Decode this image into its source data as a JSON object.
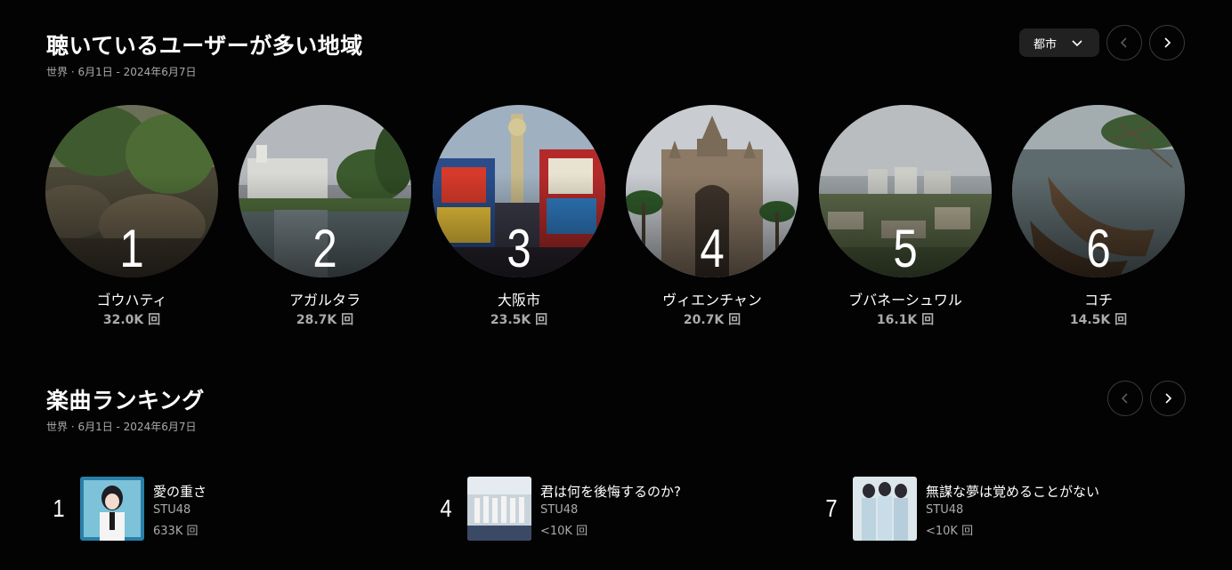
{
  "regions_section": {
    "title": "聴いているユーザーが多い地域",
    "subtitle": "世界 · 6月1日 - 2024年6月7日",
    "filter_label": "都市",
    "items": [
      {
        "rank": "1",
        "name": "ゴウハティ",
        "plays": "32.0K 回"
      },
      {
        "rank": "2",
        "name": "アガルタラ",
        "plays": "28.7K 回"
      },
      {
        "rank": "3",
        "name": "大阪市",
        "plays": "23.5K 回"
      },
      {
        "rank": "4",
        "name": "ヴィエンチャン",
        "plays": "20.7K 回"
      },
      {
        "rank": "5",
        "name": "ブバネーシュワル",
        "plays": "16.1K 回"
      },
      {
        "rank": "6",
        "name": "コチ",
        "plays": "14.5K 回"
      }
    ]
  },
  "songs_section": {
    "title": "楽曲ランキング",
    "subtitle": "世界 · 6月1日 - 2024年6月7日",
    "items": [
      {
        "rank": "1",
        "title": "愛の重さ",
        "artist": "STU48",
        "plays": "633K 回"
      },
      {
        "rank": "4",
        "title": "君は何を後悔するのか?",
        "artist": "STU48",
        "plays": "<10K 回"
      },
      {
        "rank": "7",
        "title": "無謀な夢は覚めることがない",
        "artist": "STU48",
        "plays": "<10K 回"
      }
    ]
  }
}
